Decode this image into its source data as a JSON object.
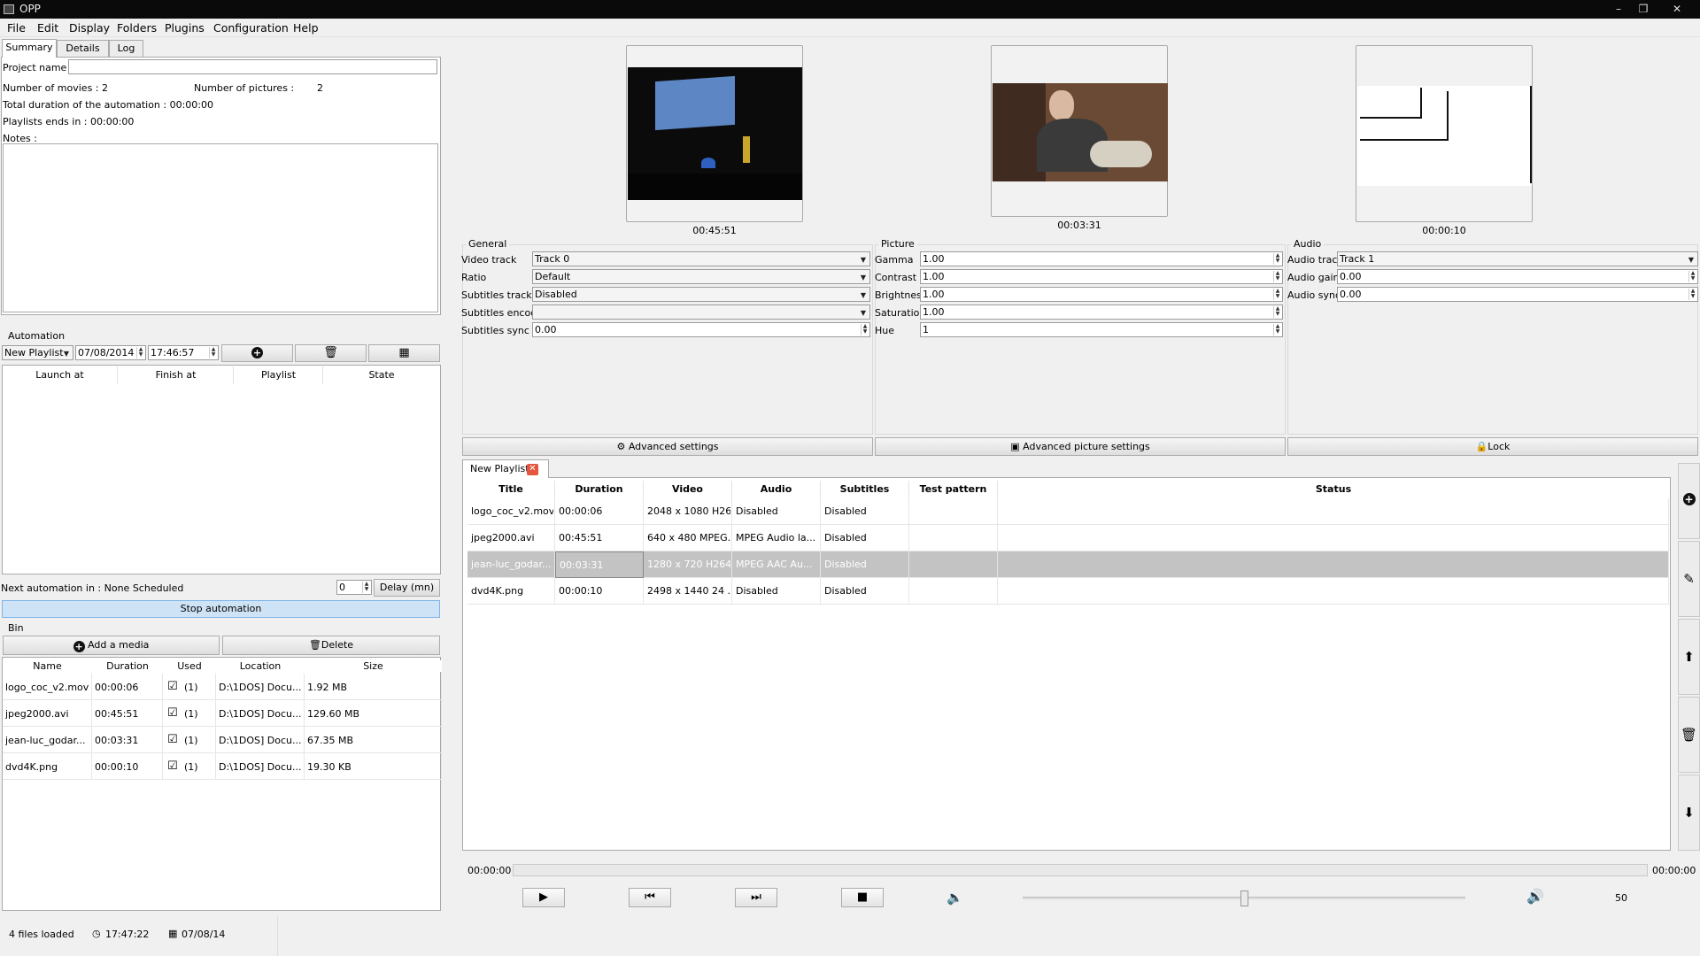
{
  "window": {
    "title": "OPP",
    "min": "–",
    "max": "❐",
    "close": "✕"
  },
  "menu": [
    "File",
    "Edit",
    "Display",
    "Folders",
    "Plugins",
    "Configuration",
    "Help"
  ],
  "left_tabs": [
    "Summary",
    "Details",
    "Log"
  ],
  "summary": {
    "project_name_label": "Project name :",
    "project_name_value": "",
    "movies_label": "Number of movies : 2",
    "pictures_label": "Number of pictures :",
    "pictures_value": "2",
    "total_duration": "Total duration of the automation :  00:00:00",
    "playlists_end": "Playlists ends in : 00:00:00",
    "notes_label": "Notes :"
  },
  "automation": {
    "title": "Automation",
    "playlist_select": "New Playlist",
    "date": "07/08/2014",
    "time": "17:46:57",
    "columns": [
      "Launch at",
      "Finish at",
      "Playlist",
      "State"
    ],
    "next_label": "Next automation in : None Scheduled",
    "delay_value": "0",
    "delay_button": "Delay (mn)",
    "stop_button": "Stop automation"
  },
  "bin": {
    "title": "Bin",
    "add_button": "Add a media",
    "delete_button": "Delete",
    "columns": [
      "Name",
      "Duration",
      "Used",
      "Location",
      "Size"
    ],
    "rows": [
      {
        "name": "logo_coc_v2.mov",
        "duration": "00:00:06",
        "used": "(1)",
        "location": "D:\\1DOS] Docu...",
        "size": "1.92 MB"
      },
      {
        "name": "jpeg2000.avi",
        "duration": "00:45:51",
        "used": "(1)",
        "location": "D:\\1DOS] Docu...",
        "size": "129.60 MB"
      },
      {
        "name": "jean-luc_godar...",
        "duration": "00:03:31",
        "used": "(1)",
        "location": "D:\\1DOS] Docu...",
        "size": "67.35 MB"
      },
      {
        "name": "dvd4K.png",
        "duration": "00:00:10",
        "used": "(1)",
        "location": "D:\\1DOS] Docu...",
        "size": "19.30 KB"
      }
    ]
  },
  "status": {
    "files": "4 files loaded",
    "time": "17:47:22",
    "date": "07/08/14"
  },
  "previews": [
    {
      "time": "00:45:51"
    },
    {
      "time": "00:03:31"
    },
    {
      "time": "00:00:10"
    }
  ],
  "general": {
    "title": "General",
    "video_track_label": "Video track",
    "video_track": "Track 0",
    "ratio_label": "Ratio",
    "ratio": "Default",
    "subtitles_track_label": "Subtitles track",
    "subtitles_track": "Disabled",
    "subtitles_encode_label": "Subtitles encode",
    "subtitles_encode": "",
    "subtitles_sync_label": "Subtitles sync",
    "subtitles_sync": "0.00"
  },
  "picture": {
    "title": "Picture",
    "gamma_label": "Gamma",
    "gamma": "1.00",
    "contrast_label": "Contrast",
    "contrast": "1.00",
    "brightness_label": "Brightness",
    "brightness": "1.00",
    "saturation_label": "Saturation",
    "saturation": "1.00",
    "hue_label": "Hue",
    "hue": "1"
  },
  "audio": {
    "title": "Audio",
    "track_label": "Audio track",
    "track": "Track 1",
    "gain_label": "Audio gain",
    "gain": "0.00",
    "sync_label": "Audio sync",
    "sync": "0.00"
  },
  "settings_buttons": {
    "advanced": "Advanced settings",
    "advanced_picture": "Advanced picture settings",
    "lock": "Lock"
  },
  "playlist": {
    "tab": "New Playlist",
    "columns": [
      "Title",
      "Duration",
      "Video",
      "Audio",
      "Subtitles",
      "Test pattern",
      "Status"
    ],
    "rows": [
      {
        "title": "logo_coc_v2.mov",
        "duration": "00:00:06",
        "video": "2048 x 1080 H26...",
        "audio": "Disabled",
        "subtitles": "Disabled",
        "test": "",
        "status": ""
      },
      {
        "title": "jpeg2000.avi",
        "duration": "00:45:51",
        "video": "640 x 480 MPEG...",
        "audio": "MPEG Audio la...",
        "subtitles": "Disabled",
        "test": "",
        "status": ""
      },
      {
        "title": "jean-luc_godar...",
        "duration": "00:03:31",
        "video": "1280 x 720 H264...",
        "audio": "MPEG AAC Au...",
        "subtitles": "Disabled",
        "test": "",
        "status": ""
      },
      {
        "title": "dvd4K.png",
        "duration": "00:00:10",
        "video": "2498 x 1440 24 ...",
        "audio": "Disabled",
        "subtitles": "Disabled",
        "test": "",
        "status": ""
      }
    ],
    "selected_row": 2
  },
  "player": {
    "position": "00:00:00",
    "total": "00:00:00",
    "volume": "50",
    "seek_fraction": 0.0,
    "volume_fraction": 0.5
  },
  "colors": {
    "selected_row": "#c3c3c3",
    "stop_button": "#cfe3f7",
    "titlebar": "#0a0a0a"
  }
}
